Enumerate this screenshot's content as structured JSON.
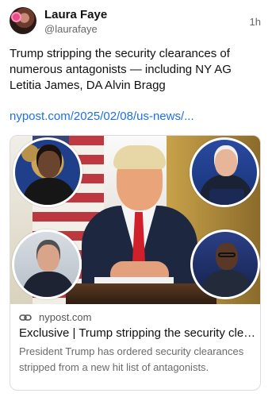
{
  "post": {
    "author": "Laura Faye",
    "handle": "@laurafaye",
    "time": "1h",
    "text": "Trump stripping the security clearances of numerous antagonists — including NY AG Letitia James, DA Alvin Bragg",
    "link": "nypost.com/2025/02/08/us-news/..."
  },
  "card": {
    "domain": "nypost.com",
    "title": "Exclusive | Trump stripping the security clearances of numerous antagonists",
    "description": "President Trump has ordered security clearances stripped from a new hit list of antagonists.",
    "icon": "link-icon"
  },
  "colors": {
    "link": "#1d6fe8",
    "muted": "#666666",
    "border": "#dcdcdc"
  }
}
